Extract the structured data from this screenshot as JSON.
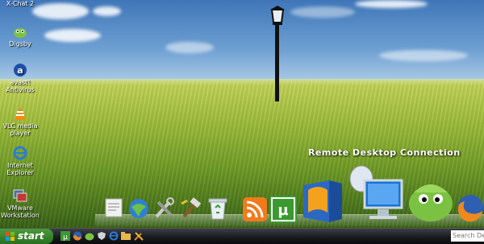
{
  "desktop": {
    "icons": [
      {
        "name": "X-Chat 2",
        "icon": "xchat-icon"
      },
      {
        "name": "Digsby",
        "icon": "digsby-icon"
      },
      {
        "name": "avast! Antivirus",
        "icon": "avast-icon"
      },
      {
        "name": "VLC media player",
        "icon": "vlc-icon"
      },
      {
        "name": "Internet Explorer",
        "icon": "ie-icon"
      },
      {
        "name": "VMware Workstation",
        "icon": "vmware-icon"
      }
    ]
  },
  "dock": {
    "active_label": "Remote Desktop Connection",
    "items": [
      {
        "icon": "notes-icon"
      },
      {
        "icon": "network-globe-icon"
      },
      {
        "icon": "tools-icon"
      },
      {
        "icon": "hammer-icon"
      },
      {
        "icon": "recycle-bin-icon"
      },
      {
        "icon": "rss-icon"
      },
      {
        "icon": "utorrent-icon"
      },
      {
        "icon": "office-icon"
      },
      {
        "icon": "remote-desktop-icon"
      },
      {
        "icon": "digsby-icon"
      },
      {
        "icon": "firefox-icon"
      }
    ]
  },
  "taskbar": {
    "start_label": "start",
    "search_placeholder": "Search Des",
    "quick_launch": [
      {
        "icon": "utorrent-icon"
      },
      {
        "icon": "firefox-icon"
      },
      {
        "icon": "digsby-icon"
      },
      {
        "icon": "shield-icon"
      },
      {
        "icon": "ie-icon"
      },
      {
        "icon": "folder-icon"
      },
      {
        "icon": "tools-icon"
      }
    ]
  },
  "colors": {
    "start_green": "#3d8c30",
    "taskbar_dark": "#16181c",
    "utorrent_green": "#3a9a2e",
    "rss_orange": "#f07a1c"
  }
}
